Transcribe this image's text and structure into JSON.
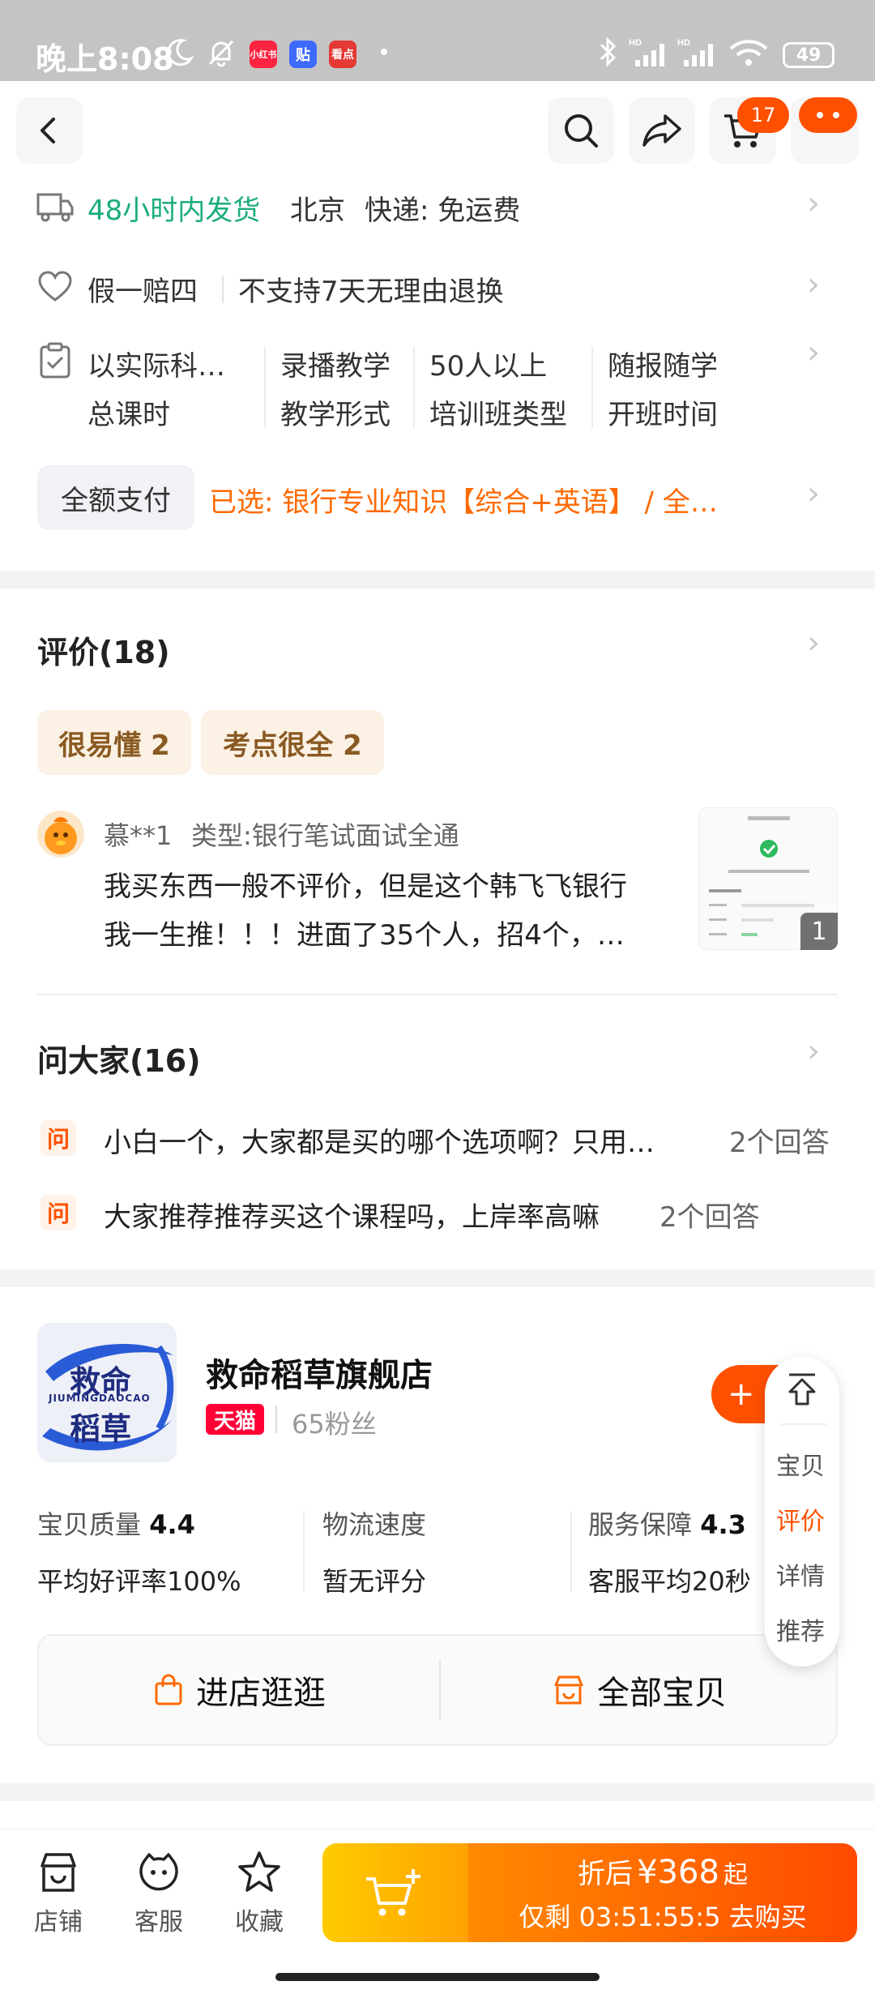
{
  "status_bar": {
    "time": "晚上8:08",
    "apps": [
      {
        "label": "小红书",
        "color": "#ff2442"
      },
      {
        "label": "贴",
        "color": "#3e6bff"
      },
      {
        "label": "看点",
        "color": "#e53935"
      }
    ],
    "battery": "49"
  },
  "header": {
    "cart_count": "17"
  },
  "shipping": {
    "fast": "48小时内发货",
    "location": "北京",
    "express": "快递: 免运费"
  },
  "guarantee": {
    "main": "假一赔四",
    "return": "不支持7天无理由退换"
  },
  "course_params": [
    {
      "value": "以实际科…",
      "label": "总课时"
    },
    {
      "value": "录播教学",
      "label": "教学形式"
    },
    {
      "value": "50人以上",
      "label": "培训班类型"
    },
    {
      "value": "随报随学",
      "label": "开班时间"
    }
  ],
  "payment": {
    "type": "全额支付",
    "selected": "已选: 银行专业知识【综合+英语】 / 全…"
  },
  "reviews": {
    "title": "评价(18)",
    "tags": [
      "很易懂 2",
      "考点很全 2"
    ],
    "item": {
      "user": "慕**1",
      "type": "类型:银行笔试面试全通",
      "line1": "我买东西一般不评价，但是这个韩飞飞银行",
      "line2": "我一生推！！！进面了35个人，招4个，…",
      "image_count": "1"
    }
  },
  "qa": {
    "title": "问大家(16)",
    "icon": "问",
    "items": [
      {
        "question": "小白一个，大家都是买的哪个选项啊？只用…",
        "answers": "2个回答"
      },
      {
        "question": "大家推荐推荐买这个课程吗，上岸率高嘛",
        "answers": "2个回答"
      }
    ]
  },
  "shop": {
    "name": "救命稻草旗舰店",
    "logo_text_1": "救命",
    "logo_text_2": "稻草",
    "logo_pinyin": "JIUMINGDAOCAO",
    "platform": "天猫",
    "fans": "65粉丝",
    "follow": "+",
    "stats": [
      {
        "label": "宝贝质量",
        "score": "4.4",
        "sub": "平均好评率100%"
      },
      {
        "label": "物流速度",
        "score": "",
        "sub": "暂无评分"
      },
      {
        "label": "服务保障",
        "score": "4.3",
        "sub": "客服平均20秒"
      }
    ],
    "enter_store": "进店逛逛",
    "all_items": "全部宝贝"
  },
  "float_nav": [
    "宝贝",
    "评价",
    "详情",
    "推荐"
  ],
  "bottom_bar": {
    "store": "店铺",
    "service": "客服",
    "favorite": "收藏",
    "price_prefix": "折后",
    "price": "¥368",
    "price_suffix": "起",
    "countdown_prefix": "仅剩",
    "countdown": "03:51:55:5",
    "buy_label": "去购买"
  },
  "colors": {
    "accent": "#ff5000",
    "green": "#1aad7a",
    "selected_orange": "#ff6a00",
    "review_tag_bg": "#fbf1e4"
  },
  "icons": [
    "back-icon",
    "search-icon",
    "share-icon",
    "cart-icon",
    "more-icon",
    "truck-icon",
    "heart-icon",
    "clipboard-icon",
    "bag-icon",
    "store-icon",
    "service-icon",
    "star-icon",
    "add-cart-icon",
    "top-arrow-icon"
  ]
}
